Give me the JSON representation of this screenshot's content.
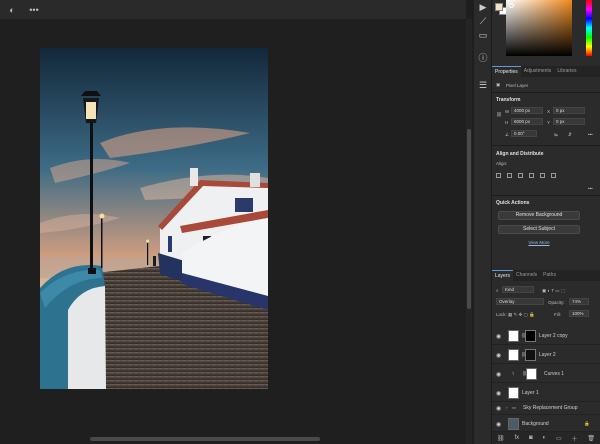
{
  "properties_panel": {
    "tabs": [
      "Properties",
      "Adjustments",
      "Libraries"
    ],
    "layer_type": "Pixel Layer",
    "transform": {
      "title": "Transform",
      "w_label": "W",
      "w_value": "4000 px",
      "h_label": "H",
      "h_value": "6000 px",
      "x_label": "X",
      "x_value": "0 px",
      "y_label": "Y",
      "y_value": "0 px",
      "angle": "0.00°"
    },
    "align": {
      "title": "Align and Distribute",
      "subtitle": "Align:"
    },
    "quick_actions": {
      "title": "Quick Actions",
      "remove_bg": "Remove Background",
      "select_subject": "Select Subject",
      "view_more": "View More"
    }
  },
  "layers_panel": {
    "tabs": [
      "Layers",
      "Channels",
      "Paths"
    ],
    "filter": "Kind",
    "blend_mode": "Overlay",
    "opacity_label": "Opacity:",
    "opacity_value": "74%",
    "lock_label": "Lock:",
    "fill_label": "Fill:",
    "fill_value": "100%",
    "layers": [
      {
        "name": "Layer 2 copy"
      },
      {
        "name": "Layer 2"
      },
      {
        "name": "Curves 1"
      },
      {
        "name": "Layer 1"
      },
      {
        "name": "Sky Replacement Group"
      },
      {
        "name": "Background"
      }
    ]
  },
  "colors": {
    "accent": "#5a9bd8",
    "foreground_swatch": "#f3e1c8",
    "background_swatch": "#ffffff"
  }
}
